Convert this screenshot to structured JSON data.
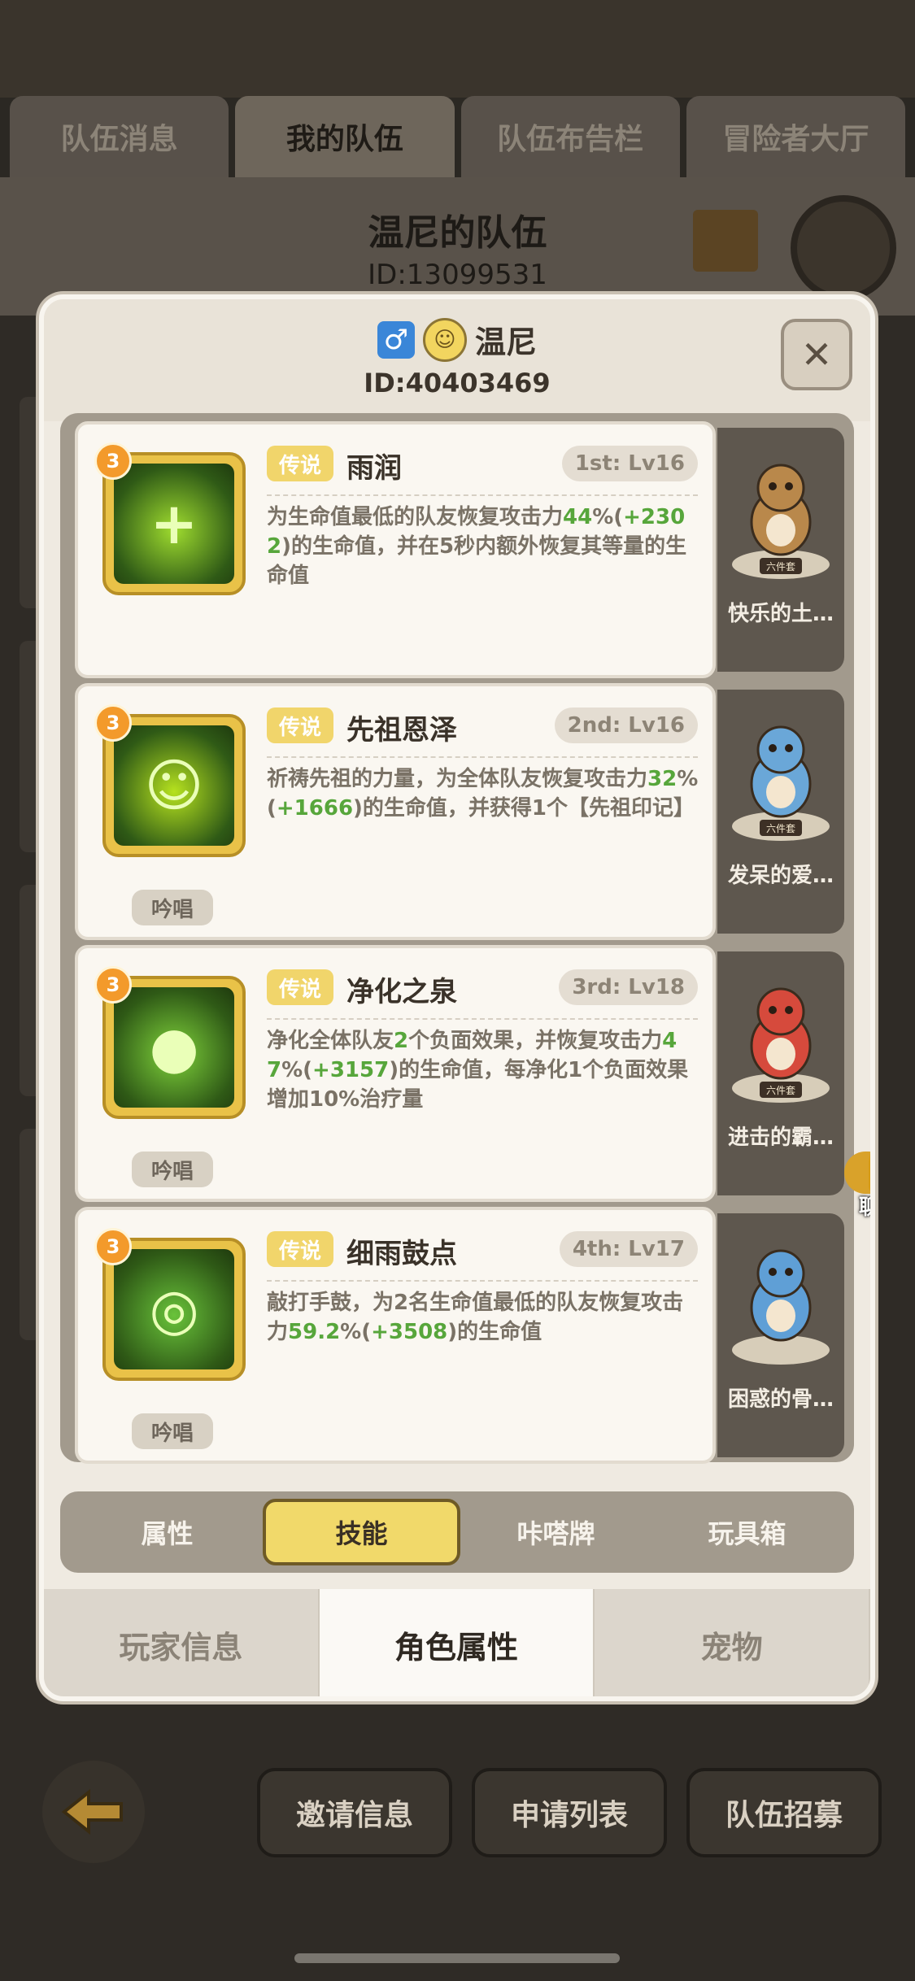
{
  "background": {
    "tabs": [
      "队伍消息",
      "我的队伍",
      "队伍布告栏",
      "冒险者大厅"
    ],
    "active_tab_index": 1,
    "team_title": "温尼的队伍",
    "team_id": "ID:13099531",
    "bottom_buttons": [
      "邀请信息",
      "申请列表",
      "队伍招募"
    ]
  },
  "player": {
    "gender_icon": "male-icon",
    "name": "温尼",
    "id": "ID:40403469"
  },
  "close_label": "✕",
  "skills": [
    {
      "badge": "3",
      "rarity": "传说",
      "name": "雨润",
      "slot": "1st: Lv16",
      "chant": "",
      "desc_parts": [
        {
          "t": "为生命值最低的队友恢复攻击力",
          "g": false
        },
        {
          "t": "44",
          "g": true
        },
        {
          "t": "%(",
          "g": false
        },
        {
          "t": "+2302",
          "g": true
        },
        {
          "t": ")的生命值，并在5秒内额外恢复其等量的生命值",
          "g": false
        }
      ],
      "accent": "#9fdc2f"
    },
    {
      "badge": "3",
      "rarity": "传说",
      "name": "先祖恩泽",
      "slot": "2nd: Lv16",
      "chant": "吟唱",
      "desc_parts": [
        {
          "t": "祈祷先祖的力量，为全体队友恢复攻击力",
          "g": false
        },
        {
          "t": "32",
          "g": true
        },
        {
          "t": "%(",
          "g": false
        },
        {
          "t": "+1666",
          "g": true
        },
        {
          "t": ")的生命值，并获得1个【先祖印记】",
          "g": false
        }
      ],
      "accent": "#b6e21f"
    },
    {
      "badge": "3",
      "rarity": "传说",
      "name": "净化之泉",
      "slot": "3rd: Lv18",
      "chant": "吟唱",
      "desc_parts": [
        {
          "t": "净化全体队友",
          "g": false
        },
        {
          "t": "2",
          "g": true
        },
        {
          "t": "个负面效果，并恢复攻击力",
          "g": false
        },
        {
          "t": "47",
          "g": true
        },
        {
          "t": "%(",
          "g": false
        },
        {
          "t": "+3157",
          "g": true
        },
        {
          "t": ")的生命值，每净化1个负面效果增加10%治疗量",
          "g": false
        }
      ],
      "accent": "#7fd23b"
    },
    {
      "badge": "3",
      "rarity": "传说",
      "name": "细雨鼓点",
      "slot": "4th: Lv17",
      "chant": "吟唱",
      "desc_parts": [
        {
          "t": "敲打手鼓，为2名生命值最低的队友恢复攻击力",
          "g": false
        },
        {
          "t": "59.2",
          "g": true
        },
        {
          "t": "%(",
          "g": false
        },
        {
          "t": "+3508",
          "g": true
        },
        {
          "t": ")的生命值",
          "g": false
        }
      ],
      "accent": "#69c23a"
    }
  ],
  "pets": [
    {
      "name": "快乐的土…",
      "base": "六件套",
      "color": "#b9884b"
    },
    {
      "name": "发呆的爱…",
      "base": "六件套",
      "color": "#6aa7d8"
    },
    {
      "name": "进击的霸…",
      "base": "六件套",
      "color": "#d64a3c"
    },
    {
      "name": "困惑的骨…",
      "base": "",
      "color": "#5f9fd6"
    }
  ],
  "chat_label": "聊天",
  "sub_tabs": [
    "属性",
    "技能",
    "咔嗒牌",
    "玩具箱"
  ],
  "active_sub_tab": 1,
  "main_tabs": [
    "玩家信息",
    "角色属性",
    "宠物"
  ],
  "active_main_tab": 1
}
